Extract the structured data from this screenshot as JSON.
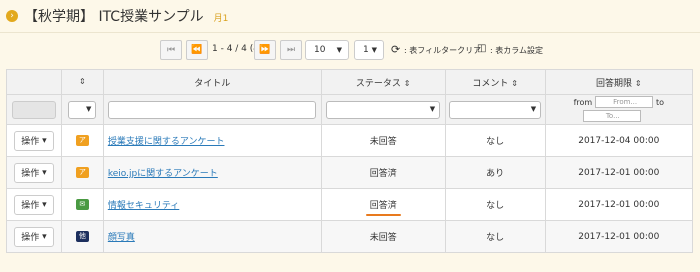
{
  "header": {
    "icon": "chevron-right-circle-icon",
    "title": "【秋学期】 ITC授業サンプル",
    "subtitle": "月1"
  },
  "toolbar": {
    "first": "⏮",
    "prev": "⏪",
    "range": "1 - 4 / 4 (4)",
    "next": "⏩",
    "last": "⏭",
    "page_size": "10",
    "page": "1",
    "clear_filter": ": 表フィルタークリア",
    "column_settings": ": 表カラム設定"
  },
  "columns": {
    "title": "タイトル",
    "status": "ステータス",
    "comment": "コメント",
    "deadline": "回答期限"
  },
  "filter": {
    "from_label": "from",
    "from_placeholder": "From...",
    "to_label": "to",
    "to_placeholder": "To..."
  },
  "rows": [
    {
      "op": "操作",
      "badge": "ア",
      "badge_color": "#f0a020",
      "title": "授業支援に関するアンケート",
      "status": "未回答",
      "comment": "なし",
      "deadline": "2017-12-04 00:00"
    },
    {
      "op": "操作",
      "badge": "ア",
      "badge_color": "#f0a020",
      "title": "keio.jpに関するアンケート",
      "status": "回答済",
      "comment": "あり",
      "deadline": "2017-12-01 00:00"
    },
    {
      "op": "操作",
      "badge": "✉",
      "badge_color": "#4a9a42",
      "title": "情報セキュリティ",
      "status": "回答済",
      "comment": "なし",
      "deadline": "2017-12-01 00:00"
    },
    {
      "op": "操作",
      "badge": "他",
      "badge_color": "#1c2f5e",
      "title": "顔写真",
      "status": "未回答",
      "comment": "なし",
      "deadline": "2017-12-01 00:00"
    }
  ]
}
